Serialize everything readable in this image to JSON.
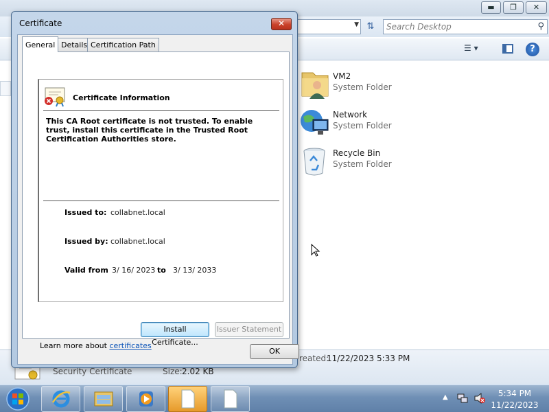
{
  "explorer": {
    "search_placeholder": "Search Desktop",
    "items": [
      {
        "name": "VM2",
        "type": "System Folder",
        "icon": "user-folder-icon"
      },
      {
        "name": "Network",
        "type": "System Folder",
        "icon": "network-globe-icon"
      },
      {
        "name": "Recycle Bin",
        "type": "System Folder",
        "icon": "recycle-bin-icon"
      }
    ],
    "details": {
      "name": "Security Certificate",
      "size_label": "Size:",
      "size": "2.02 KB",
      "created_label": "reated:",
      "created": "11/22/2023 5:33 PM"
    }
  },
  "dialog": {
    "title": "Certificate",
    "tabs": [
      "General",
      "Details",
      "Certification Path"
    ],
    "heading": "Certificate Information",
    "message": "This CA Root certificate is not trusted. To enable trust, install this certificate in the Trusted Root Certification Authorities store.",
    "issued_to_label": "Issued to:",
    "issued_to": "collabnet.local",
    "issued_by_label": "Issued by:",
    "issued_by": "collabnet.local",
    "valid_from_label": "Valid from",
    "valid_from": "3/ 16/ 2023",
    "valid_to_label": "to",
    "valid_to": "3/ 13/ 2033",
    "install_button": "Install Certificate...",
    "issuer_button": "Issuer Statement",
    "learn_more_text": "Learn more about ",
    "learn_more_link": "certificates",
    "ok_button": "OK"
  },
  "taskbar": {
    "time": "5:34 PM",
    "date": "11/22/2023"
  },
  "colors": {
    "dialog_frame": "#b3c9e1",
    "link": "#0a53b8",
    "taskbar": "#6f8fb5"
  }
}
